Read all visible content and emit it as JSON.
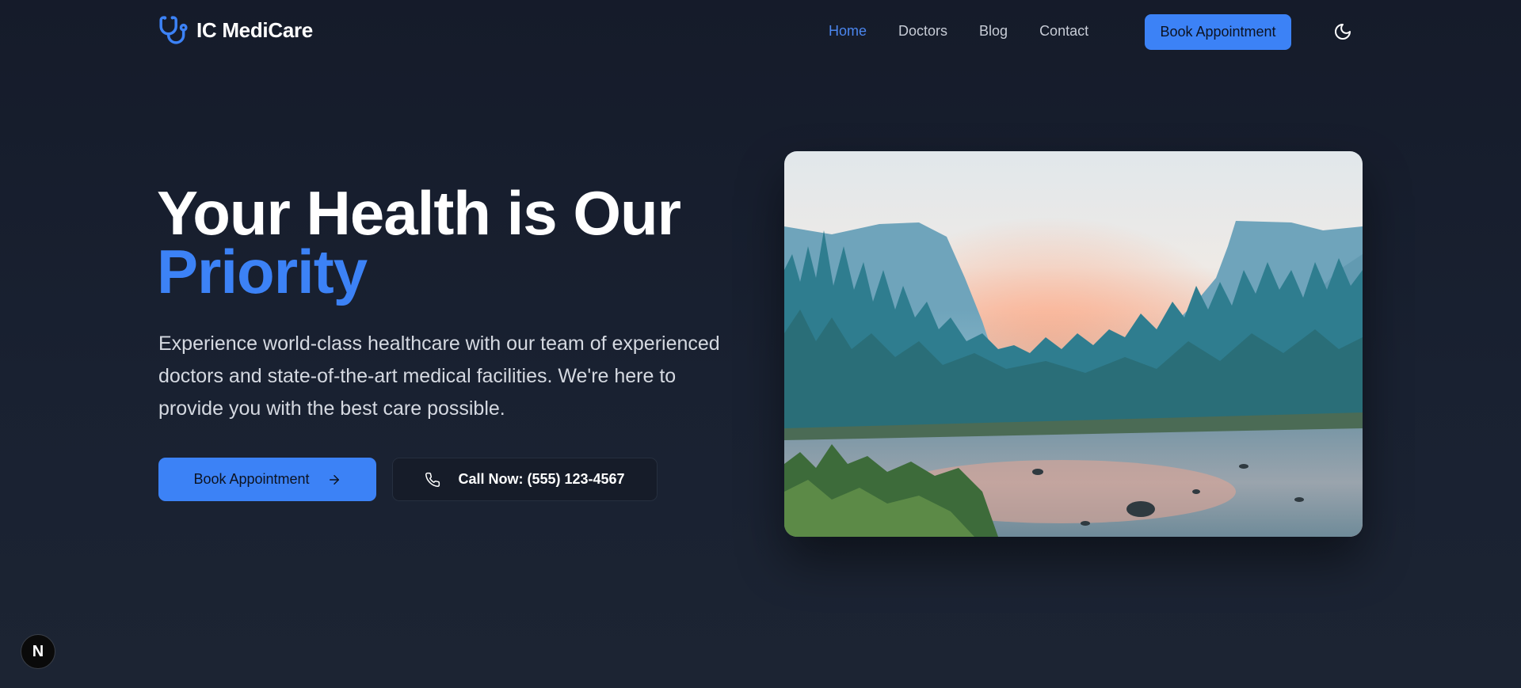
{
  "brand": {
    "name": "IC MediCare",
    "logo_icon": "stethoscope-icon",
    "accent": "#3c82f6"
  },
  "nav": {
    "links": [
      {
        "label": "Home",
        "active": true
      },
      {
        "label": "Doctors",
        "active": false
      },
      {
        "label": "Blog",
        "active": false
      },
      {
        "label": "Contact",
        "active": false
      }
    ],
    "book_label": "Book Appointment",
    "theme_icon": "moon-icon"
  },
  "hero": {
    "title_line1": "Your Health is Our",
    "title_line2": "Priority",
    "description": "Experience world-class healthcare with our team of experienced doctors and state-of-the-art medical facilities. We're here to provide you with the best care possible.",
    "primary_cta": "Book Appointment",
    "secondary_cta": "Call Now: (555) 123-4567",
    "image_icon": "landscape-image"
  },
  "dev_badge": {
    "label": "N"
  }
}
